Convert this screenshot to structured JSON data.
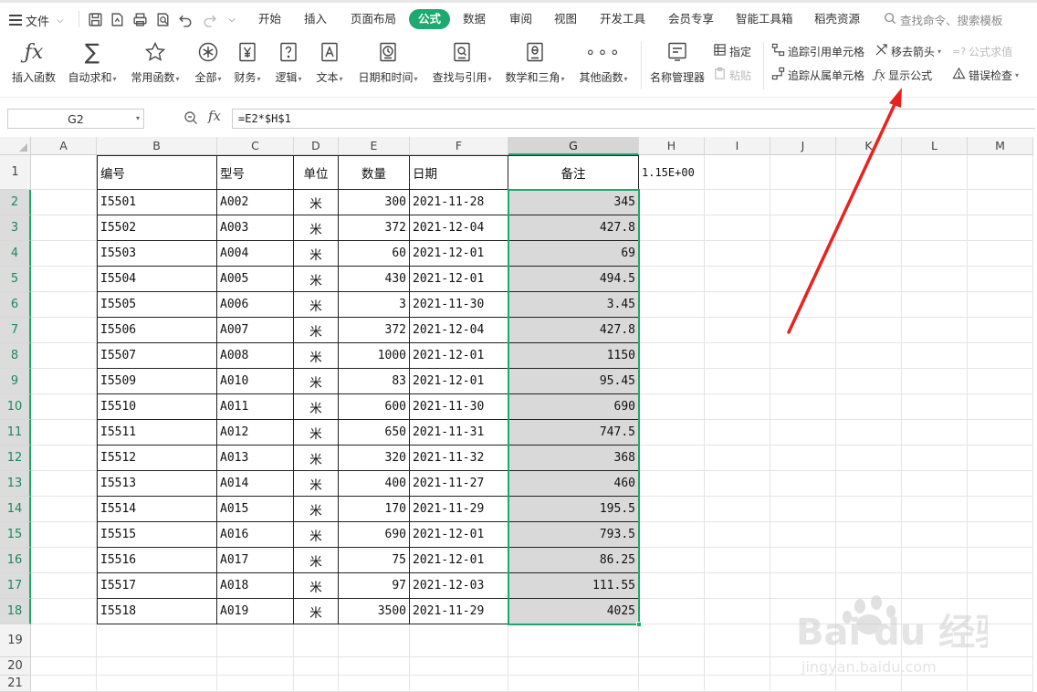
{
  "menubar": {
    "file_label": "文件",
    "tabs": [
      "开始",
      "插入",
      "页面布局",
      "公式",
      "数据",
      "审阅",
      "视图",
      "开发工具",
      "会员专享",
      "智能工具箱",
      "稻壳资源"
    ],
    "active_tab": "公式",
    "search_label": "查找命令、搜索模板"
  },
  "ribbon": {
    "buttons": [
      {
        "label": "插入函数",
        "icon": "fx-icon",
        "dropdown": false
      },
      {
        "label": "自动求和",
        "icon": "sigma-icon",
        "dropdown": true
      },
      {
        "label": "常用函数",
        "icon": "star-icon",
        "dropdown": true
      },
      {
        "label": "全部",
        "icon": "asterisk-icon",
        "dropdown": true
      },
      {
        "label": "财务",
        "icon": "yen-icon",
        "dropdown": true
      },
      {
        "label": "逻辑",
        "icon": "question-icon",
        "dropdown": true
      },
      {
        "label": "文本",
        "icon": "text-a-icon",
        "dropdown": true
      },
      {
        "label": "日期和时间",
        "icon": "clock-icon",
        "dropdown": true
      },
      {
        "label": "查找与引用",
        "icon": "find-ref-icon",
        "dropdown": true
      },
      {
        "label": "数学和三角",
        "icon": "theta-icon",
        "dropdown": true
      },
      {
        "label": "其他函数",
        "icon": "more-dots-icon",
        "dropdown": true
      },
      {
        "label": "名称管理器",
        "icon": "name-manager-icon",
        "dropdown": false
      }
    ],
    "small": {
      "specify": "指定",
      "paste": "粘贴",
      "trace_precedents": "追踪引用单元格",
      "trace_dependents": "追踪从属单元格",
      "remove_arrows": "移去箭头",
      "show_formulas": "显示公式",
      "evaluate_formula": "公式求值",
      "error_checking": "错误检查"
    }
  },
  "formula_bar": {
    "name_box": "G2",
    "fx": "fx",
    "formula": "=E2*$H$1"
  },
  "sheet": {
    "columns": [
      "A",
      "B",
      "C",
      "D",
      "E",
      "F",
      "G",
      "H",
      "I",
      "J",
      "K",
      "L",
      "M"
    ],
    "selected_column": "G",
    "row_numbers": [
      "1",
      "2",
      "3",
      "4",
      "5",
      "6",
      "7",
      "8",
      "9",
      "10",
      "11",
      "12",
      "13",
      "14",
      "15",
      "16",
      "17",
      "18",
      "19",
      "20",
      "21"
    ],
    "headers": {
      "B": "编号",
      "C": "型号",
      "D": "单位",
      "E": "数量",
      "F": "日期",
      "G": "备注"
    },
    "h1": "1.15E+00",
    "rows": [
      [
        "I5501",
        "A002",
        "米",
        "300",
        "2021-11-28",
        "345"
      ],
      [
        "I5502",
        "A003",
        "米",
        "372",
        "2021-12-04",
        "427.8"
      ],
      [
        "I5503",
        "A004",
        "米",
        "60",
        "2021-12-01",
        "69"
      ],
      [
        "I5504",
        "A005",
        "米",
        "430",
        "2021-12-01",
        "494.5"
      ],
      [
        "I5505",
        "A006",
        "米",
        "3",
        "2021-11-30",
        "3.45"
      ],
      [
        "I5506",
        "A007",
        "米",
        "372",
        "2021-12-04",
        "427.8"
      ],
      [
        "I5507",
        "A008",
        "米",
        "1000",
        "2021-12-01",
        "1150"
      ],
      [
        "I5509",
        "A010",
        "米",
        "83",
        "2021-12-01",
        "95.45"
      ],
      [
        "I5510",
        "A011",
        "米",
        "600",
        "2021-11-30",
        "690"
      ],
      [
        "I5511",
        "A012",
        "米",
        "650",
        "2021-11-31",
        "747.5"
      ],
      [
        "I5512",
        "A013",
        "米",
        "320",
        "2021-11-32",
        "368"
      ],
      [
        "I5513",
        "A014",
        "米",
        "400",
        "2021-11-27",
        "460"
      ],
      [
        "I5514",
        "A015",
        "米",
        "170",
        "2021-11-29",
        "195.5"
      ],
      [
        "I5515",
        "A016",
        "米",
        "690",
        "2021-12-01",
        "793.5"
      ],
      [
        "I5516",
        "A017",
        "米",
        "75",
        "2021-12-01",
        "86.25"
      ],
      [
        "I5517",
        "A018",
        "米",
        "97",
        "2021-12-03",
        "111.55"
      ],
      [
        "I5518",
        "A019",
        "米",
        "3500",
        "2021-11-29",
        "4025"
      ]
    ]
  },
  "watermark": {
    "brand": "Bai du 经验",
    "url": "jingyan.baidu.com"
  },
  "colors": {
    "accent": "#1fa870",
    "selection_fill": "#d9d9d9",
    "arrow": "#e8231f"
  }
}
